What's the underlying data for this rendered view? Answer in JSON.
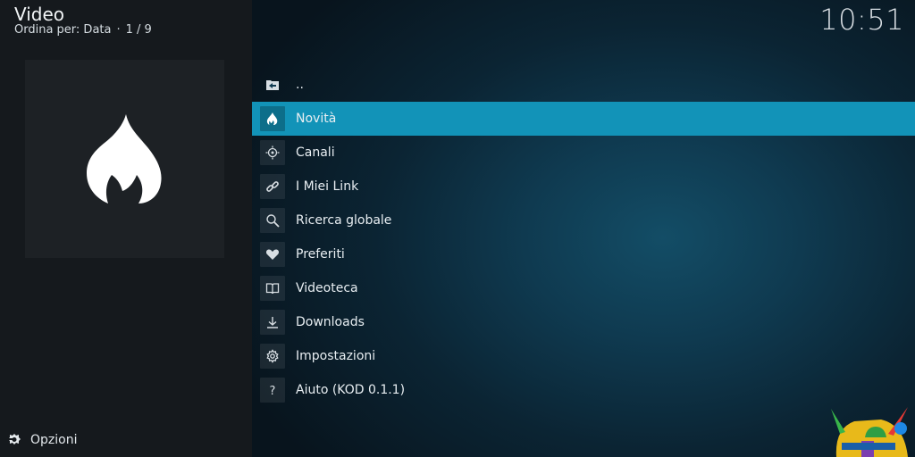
{
  "header": {
    "title": "Video",
    "sort_label": "Ordina per: Data",
    "separator": "·",
    "count": "1 / 9"
  },
  "clock": "10:51",
  "thumbnail": {
    "icon": "flame-icon"
  },
  "footer": {
    "options_label": "Opzioni",
    "options_icon": "options-icon"
  },
  "list": {
    "items": [
      {
        "label": "..",
        "icon": "folder-back-icon",
        "selected": false
      },
      {
        "label": "Novità",
        "icon": "flame-icon",
        "selected": true
      },
      {
        "label": "Canali",
        "icon": "channels-icon",
        "selected": false
      },
      {
        "label": "I Miei Link",
        "icon": "link-icon",
        "selected": false
      },
      {
        "label": "Ricerca globale",
        "icon": "search-icon",
        "selected": false
      },
      {
        "label": "Preferiti",
        "icon": "heart-icon",
        "selected": false
      },
      {
        "label": "Videoteca",
        "icon": "book-icon",
        "selected": false
      },
      {
        "label": "Downloads",
        "icon": "download-icon",
        "selected": false
      },
      {
        "label": "Impostazioni",
        "icon": "gear-icon",
        "selected": false
      },
      {
        "label": "Aiuto (KOD 0.1.1)",
        "icon": "help-icon",
        "selected": false
      }
    ]
  },
  "colors": {
    "selected": "#1293b8",
    "left_panel": "#15191d",
    "thumbnail_bg": "#1d2125"
  }
}
